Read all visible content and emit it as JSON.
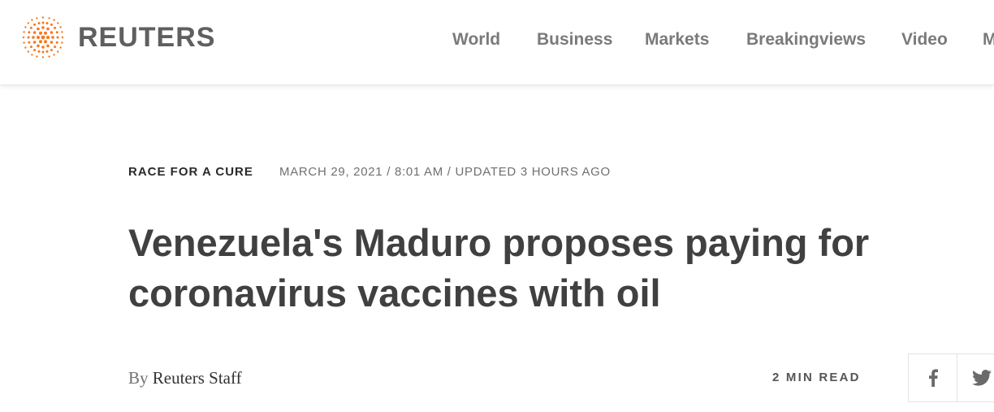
{
  "brand": {
    "name": "REUTERS",
    "color": "#f47920"
  },
  "nav": {
    "items": [
      "World",
      "Business",
      "Markets",
      "Breakingviews",
      "Video",
      "M"
    ]
  },
  "article": {
    "kicker": "RACE FOR A CURE",
    "dateline": "MARCH 29, 2021 / 8:01 AM / UPDATED 3 HOURS AGO",
    "headline": "Venezuela's Maduro proposes paying for coronavirus vaccines with oil",
    "byline": {
      "prefix": "By",
      "author": "Reuters Staff"
    },
    "read_time": "2 MIN READ"
  },
  "share": {
    "icons": [
      "facebook-icon",
      "twitter-icon"
    ]
  }
}
